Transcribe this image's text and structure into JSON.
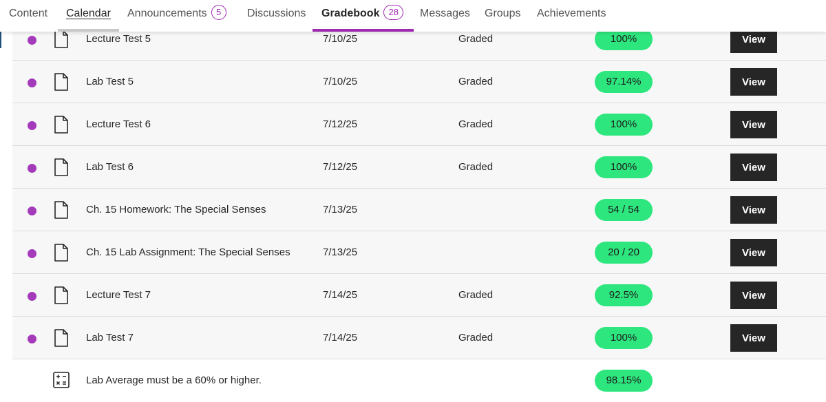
{
  "nav": {
    "tabs": [
      {
        "label": "Content"
      },
      {
        "label": "Calendar"
      },
      {
        "label": "Announcements",
        "badge": "5"
      },
      {
        "label": "Discussions"
      },
      {
        "label": "Gradebook",
        "badge": "28"
      },
      {
        "label": "Messages"
      },
      {
        "label": "Groups"
      },
      {
        "label": "Achievements"
      }
    ],
    "active_tab": "Gradebook",
    "accent_color": "#9e2ab0"
  },
  "grades": {
    "rows": [
      {
        "title": "Lecture Test 5",
        "date": "7/10/25",
        "status": "Graded",
        "grade": "100%",
        "action": "View"
      },
      {
        "title": "Lab Test 5",
        "date": "7/10/25",
        "status": "Graded",
        "grade": "97.14%",
        "action": "View"
      },
      {
        "title": "Lecture Test 6",
        "date": "7/12/25",
        "status": "Graded",
        "grade": "100%",
        "action": "View"
      },
      {
        "title": "Lab Test 6",
        "date": "7/12/25",
        "status": "Graded",
        "grade": "100%",
        "action": "View"
      },
      {
        "title": "Ch. 15 Homework: The Special Senses",
        "date": "7/13/25",
        "status": "",
        "grade": "54 / 54",
        "action": "View"
      },
      {
        "title": "Ch. 15 Lab Assignment: The Special Senses",
        "date": "7/13/25",
        "status": "",
        "grade": "20 / 20",
        "action": "View"
      },
      {
        "title": "Lecture Test 7",
        "date": "7/14/25",
        "status": "Graded",
        "grade": "92.5%",
        "action": "View"
      },
      {
        "title": "Lab Test 7",
        "date": "7/14/25",
        "status": "Graded",
        "grade": "100%",
        "action": "View"
      }
    ],
    "summary": {
      "title": "Lab Average must be a 60% or higher.",
      "grade": "98.15%"
    }
  },
  "colors": {
    "unread_dot": "#a43bbb",
    "grade_pill": "#2ee67e",
    "view_button": "#262626"
  }
}
